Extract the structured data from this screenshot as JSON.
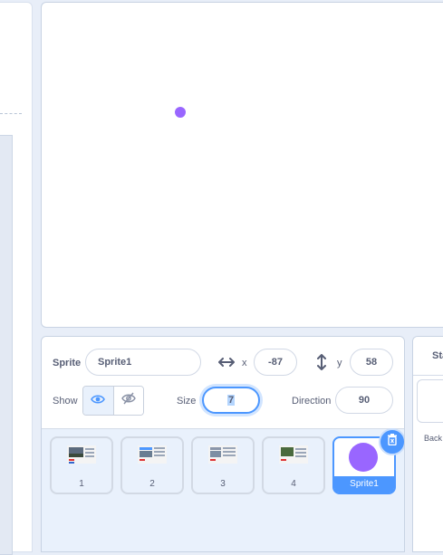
{
  "sprite_info": {
    "sprite_label": "Sprite",
    "sprite_name": "Sprite1",
    "x_label": "x",
    "x_value": "-87",
    "y_label": "y",
    "y_value": "58",
    "show_label": "Show",
    "size_label": "Size",
    "size_value": "7",
    "direction_label": "Direction",
    "direction_value": "90"
  },
  "sprites": [
    {
      "label": "1"
    },
    {
      "label": "2"
    },
    {
      "label": "3"
    },
    {
      "label": "4"
    },
    {
      "label": "Sprite1"
    }
  ],
  "stage_panel": {
    "header": "Sta",
    "backdrops_label": "Back"
  },
  "colors": {
    "accent": "#4c97ff",
    "sprite": "#9966ff"
  }
}
